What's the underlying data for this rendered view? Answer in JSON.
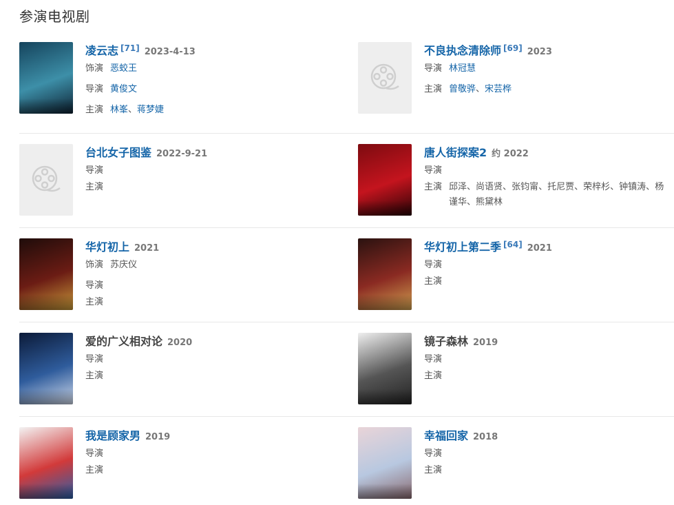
{
  "section_title": "参演电视剧",
  "items": [
    {
      "title": "凌云志",
      "linked": true,
      "cite": "[71]",
      "year": "2023-4-13",
      "role_label": "饰演",
      "role": "恶蛟王",
      "role_linked": true,
      "director_label": "导演",
      "directors": [
        "黄俊文"
      ],
      "cast_label": "主演",
      "cast": [
        "林峯",
        "蒋梦婕"
      ],
      "poster": "poster-1",
      "colors": [
        "#15435c",
        "#3d8fa8",
        "#0e2233"
      ]
    },
    {
      "title": "不良执念清除师",
      "linked": true,
      "cite": "[69]",
      "year": "2023",
      "director_label": "导演",
      "directors": [
        "林冠慧"
      ],
      "cast_label": "主演",
      "cast": [
        "曾敬骅",
        "宋芸桦"
      ],
      "poster": "placeholder"
    },
    {
      "title": "台北女子图鉴",
      "linked": true,
      "cite": "",
      "year": "2022-9-21",
      "director_label": "导演",
      "directors": [],
      "cast_label": "主演",
      "cast": [],
      "poster": "placeholder"
    },
    {
      "title": "唐人街探案2",
      "linked": true,
      "cite": "",
      "year": "约 2022",
      "director_label": "导演",
      "directors": [],
      "cast_label": "主演",
      "cast": [
        "邱泽",
        "尚语贤",
        "张钧甯",
        "托尼贾",
        "荣梓杉",
        "钟镇涛",
        "杨谨华",
        "熊黛林"
      ],
      "cast_plain": true,
      "poster": "poster-4",
      "colors": [
        "#7d0b10",
        "#c4141e",
        "#2a0306"
      ]
    },
    {
      "title": "华灯初上",
      "linked": true,
      "cite": "",
      "year": "2021",
      "role_label": "饰演",
      "role": "苏庆仪",
      "role_linked": false,
      "director_label": "导演",
      "directors": [],
      "cast_label": "主演",
      "cast": [],
      "poster": "poster-5",
      "colors": [
        "#1e0c0a",
        "#6b1c14",
        "#c89a3a"
      ]
    },
    {
      "title": "华灯初上第二季",
      "linked": true,
      "cite": "[64]",
      "year": "2021",
      "director_label": "导演",
      "directors": [],
      "cast_label": "主演",
      "cast": [],
      "poster": "poster-6",
      "colors": [
        "#2a1210",
        "#8a2a22",
        "#d0a050"
      ]
    },
    {
      "title": "爱的广义相对论",
      "linked": false,
      "cite": "",
      "year": "2020",
      "director_label": "导演",
      "directors": [],
      "cast_label": "主演",
      "cast": [],
      "poster": "poster-7",
      "colors": [
        "#0b1a38",
        "#2f5c9c",
        "#cfd9ea"
      ]
    },
    {
      "title": "镜子森林",
      "linked": false,
      "cite": "",
      "year": "2019",
      "director_label": "导演",
      "directors": [],
      "cast_label": "主演",
      "cast": [],
      "poster": "poster-8",
      "colors": [
        "#efefef",
        "#555555",
        "#222222"
      ]
    },
    {
      "title": "我是顾家男",
      "linked": true,
      "cite": "",
      "year": "2019",
      "director_label": "导演",
      "directors": [],
      "cast_label": "主演",
      "cast": [],
      "poster": "poster-9",
      "colors": [
        "#f3f3f3",
        "#d23a3a",
        "#2a5fa8"
      ]
    },
    {
      "title": "幸福回家",
      "linked": true,
      "cite": "",
      "year": "2018",
      "director_label": "导演",
      "directors": [],
      "cast_label": "主演",
      "cast": [],
      "poster": "poster-10",
      "colors": [
        "#e9d4d8",
        "#b8c8e0",
        "#8a6a70"
      ]
    }
  ]
}
